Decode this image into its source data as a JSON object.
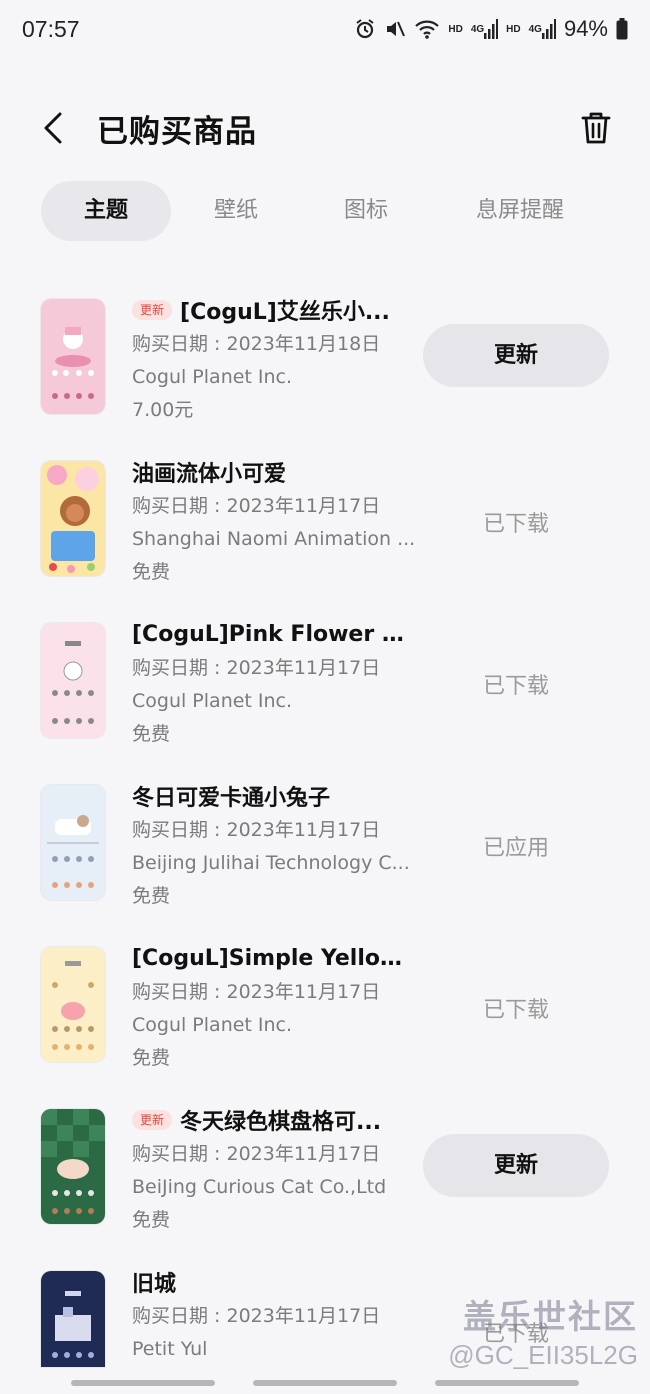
{
  "status": {
    "time": "07:57",
    "battery": "94%",
    "hd1": "HD",
    "hd2": "HD",
    "net1": "4G",
    "net2": "4G"
  },
  "header": {
    "title": "已购买商品"
  },
  "tabs": [
    {
      "label": "主题",
      "active": true
    },
    {
      "label": "壁纸",
      "active": false
    },
    {
      "label": "图标",
      "active": false
    },
    {
      "label": "息屏提醒",
      "active": false
    }
  ],
  "items": [
    {
      "badge": "更新",
      "name": "[CoguL]艾丝乐小...",
      "date": "购买日期 : 2023年11月18日",
      "vendor": "Cogul Planet Inc.",
      "price": "7.00元",
      "action": "更新"
    },
    {
      "name": "油画流体小可爱",
      "date": "购买日期 : 2023年11月17日",
      "vendor": "Shanghai Naomi Animation ...",
      "price": "免费",
      "status": "已下载"
    },
    {
      "name": "[CoguL]Pink Flower G...",
      "date": "购买日期 : 2023年11月17日",
      "vendor": "Cogul Planet Inc.",
      "price": "免费",
      "status": "已下载"
    },
    {
      "name": "冬日可爱卡通小兔子",
      "date": "购买日期 : 2023年11月17日",
      "vendor": "Beijing Julihai Technology C...",
      "price": "免费",
      "status": "已应用"
    },
    {
      "name": "[CoguL]Simple Yellow...",
      "date": "购买日期 : 2023年11月17日",
      "vendor": "Cogul Planet Inc.",
      "price": "免费",
      "status": "已下载"
    },
    {
      "badge": "更新",
      "name": "冬天绿色棋盘格可...",
      "date": "购买日期 : 2023年11月17日",
      "vendor": "BeiJing Curious Cat Co.,Ltd",
      "price": "免费",
      "action": "更新"
    },
    {
      "name": "旧城",
      "date": "购买日期 : 2023年11月17日",
      "vendor": "Petit Yul",
      "status": "已下载"
    }
  ],
  "watermark": {
    "line1": "盖乐世社区",
    "line2": "@GC_EII35L2G"
  },
  "colors": {
    "background": "#f6f6f8",
    "badge_text": "#e2483e",
    "badge_bg": "#fbe1df",
    "button_bg": "#e6e6ea"
  }
}
